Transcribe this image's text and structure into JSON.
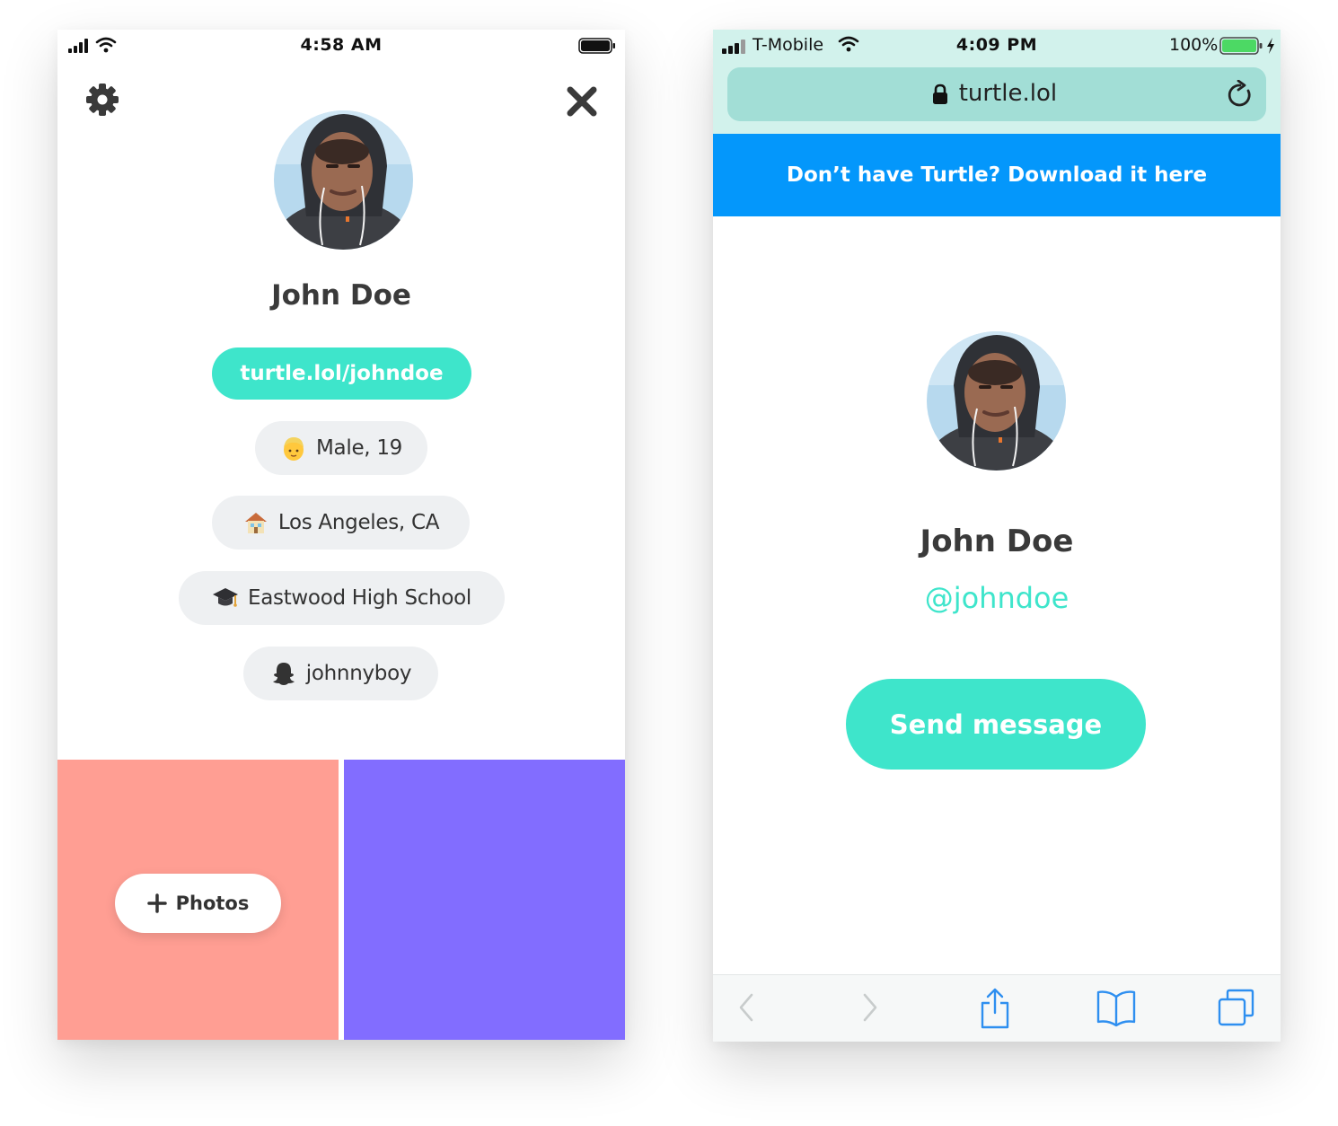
{
  "left_screen": {
    "status_bar": {
      "time": "4:58 AM"
    },
    "profile": {
      "name": "John Doe",
      "link": "turtle.lol/johndoe",
      "info": [
        {
          "icon": "person-emoji-icon",
          "label": "Male, 19"
        },
        {
          "icon": "house-emoji-icon",
          "label": "Los Angeles, CA"
        },
        {
          "icon": "graduation-cap-icon",
          "label": "Eastwood High School"
        },
        {
          "icon": "snapchat-ghost-icon",
          "label": "johnnyboy"
        }
      ]
    },
    "tiles": {
      "colors": [
        "#ff9e93",
        "#826dff"
      ],
      "photos_button": "Photos"
    }
  },
  "right_screen": {
    "status_bar": {
      "carrier": "T-Mobile",
      "time": "4:09 PM",
      "battery": "100%"
    },
    "url": "turtle.lol",
    "banner": "Don’t have Turtle? Download it here",
    "profile": {
      "name": "John Doe",
      "handle": "@johndoe"
    },
    "send_button": "Send message"
  },
  "colors": {
    "accent": "#3ee5cb",
    "banner": "#0497fb",
    "url_bar": "#a2ded6",
    "status_bar": "#d2f2ec"
  }
}
